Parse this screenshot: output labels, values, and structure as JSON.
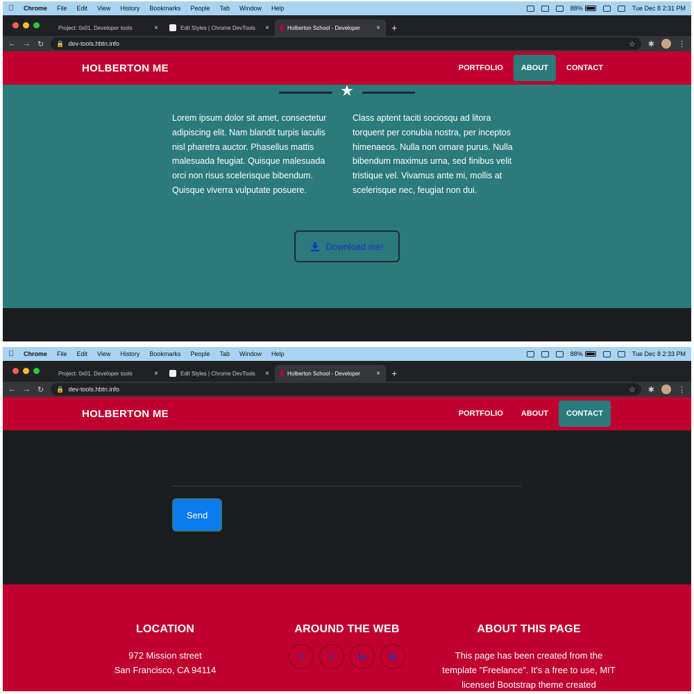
{
  "shots": [
    {
      "menubar": {
        "app": "Chrome",
        "items": [
          "File",
          "Edit",
          "View",
          "History",
          "Bookmarks",
          "People",
          "Tab",
          "Window",
          "Help"
        ],
        "battery": "88%",
        "datetime": "Tue Dec 8  2:31 PM"
      },
      "tabs": [
        {
          "title": "Project: 0x01. Developer tools",
          "close": "×"
        },
        {
          "title": "Edit Styles | Chrome DevTools",
          "close": "×"
        },
        {
          "title": "Holberton School - Developer",
          "close": "×"
        }
      ],
      "new_tab": "+",
      "url": "dev-tools.hbtn.info",
      "navbar": {
        "brand": "HOLBERTON ME",
        "links": [
          "PORTFOLIO",
          "ABOUT",
          "CONTACT"
        ],
        "active": "ABOUT"
      },
      "about": {
        "left_text": "Lorem ipsum dolor sit amet, consectetur adipiscing elit. Nam blandit turpis iaculis nisl pharetra auctor. Phasellus mattis malesuada feugiat. Quisque malesuada orci non risus scelerisque bibendum. Quisque viverra vulputate posuere.",
        "right_text": "Class aptent taciti sociosqu ad litora torquent per conubia nostra, per inceptos himenaeos. Nulla non ornare purus. Nulla bibendum maximus urna, sed finibus velit tristique vel. Vivamus ante mi, mollis at scelerisque nec, feugiat non dui.",
        "download_label": "Download me!"
      }
    },
    {
      "menubar": {
        "app": "Chrome",
        "items": [
          "File",
          "Edit",
          "View",
          "History",
          "Bookmarks",
          "People",
          "Tab",
          "Window",
          "Help"
        ],
        "battery": "88%",
        "datetime": "Tue Dec 8  2:33 PM"
      },
      "tabs": [
        {
          "title": "Project: 0x01. Developer tools",
          "close": "×"
        },
        {
          "title": "Edit Styles | Chrome DevTools",
          "close": "×"
        },
        {
          "title": "Holberton School - Developer",
          "close": "×"
        }
      ],
      "new_tab": "+",
      "url": "dev-tools.hbtn.info",
      "navbar": {
        "brand": "HOLBERTON ME",
        "links": [
          "PORTFOLIO",
          "ABOUT",
          "CONTACT"
        ],
        "active": "CONTACT"
      },
      "contact": {
        "send_label": "Send"
      },
      "footer": {
        "location_title": "LOCATION",
        "location_line1": "972 Mission street",
        "location_line2": "San Francisco, CA 94114",
        "web_title": "AROUND THE WEB",
        "socials": [
          "f",
          "t",
          "in",
          "◎"
        ],
        "about_title": "ABOUT THIS PAGE",
        "about_text": "This page has been created from the template \"Freelance\". It's a free to use, MIT licensed Bootstrap theme created"
      }
    }
  ],
  "colors": {
    "brand_red": "#c0002f",
    "teal": "#2b7a7c",
    "dark": "#1b1d20",
    "link_blue": "#1634c8",
    "send_blue": "#0d7bf0"
  }
}
